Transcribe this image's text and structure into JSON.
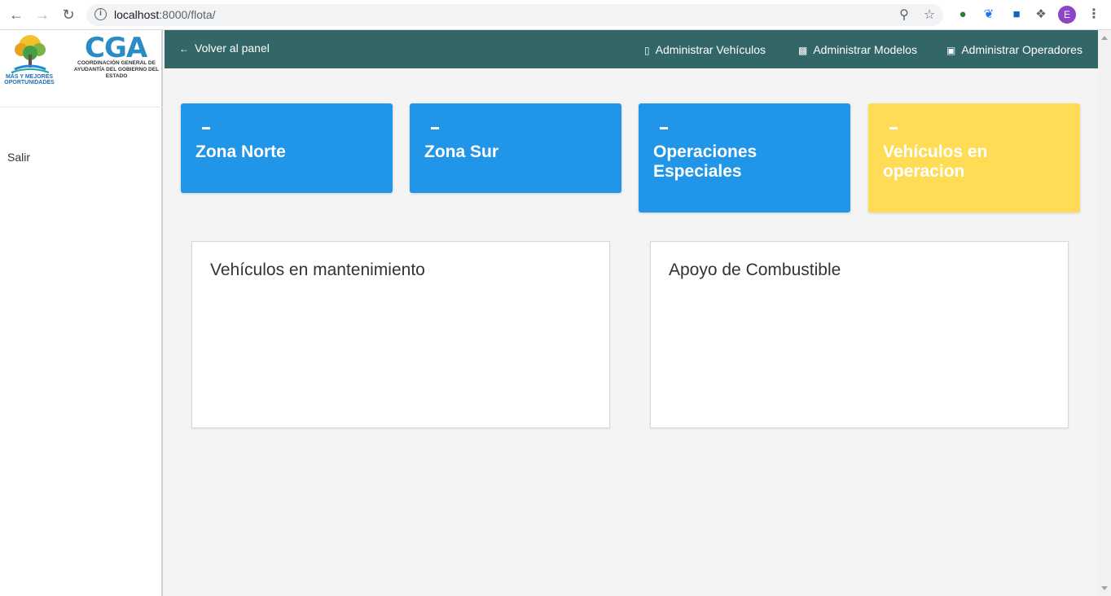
{
  "browser": {
    "url_host": "localhost",
    "url_path": ":8000/flota/",
    "profile_initial": "E"
  },
  "sidebar": {
    "logo_left_text": "MÁS Y MEJORES OPORTUNIDADES",
    "logo_right_title": "CGA",
    "logo_right_sub": "COORDINACIÓN GENERAL DE AYUDANTÍA DEL GOBIERNO DEL ESTADO",
    "logout_label": "Salir"
  },
  "topnav": {
    "back_label": "Volver al panel",
    "vehicles_label": "Administrar Vehículos",
    "models_label": "Administrar Modelos",
    "operators_label": "Administrar Operadores"
  },
  "zones": [
    {
      "title": "Zona Norte",
      "color": "#2196e8"
    },
    {
      "title": "Zona Sur",
      "color": "#2196e8"
    },
    {
      "title": "Operaciones Especiales",
      "color": "#2196e8"
    },
    {
      "title": "Vehículos en operacion",
      "color": "#ffdc55"
    }
  ],
  "panels": {
    "maintenance_title": "Vehículos en mantenimiento",
    "fuel_title": "Apoyo de Combustible"
  },
  "colors": {
    "topnav_bg": "#336666",
    "card_blue": "#2196e8",
    "card_yellow": "#ffdc55"
  }
}
